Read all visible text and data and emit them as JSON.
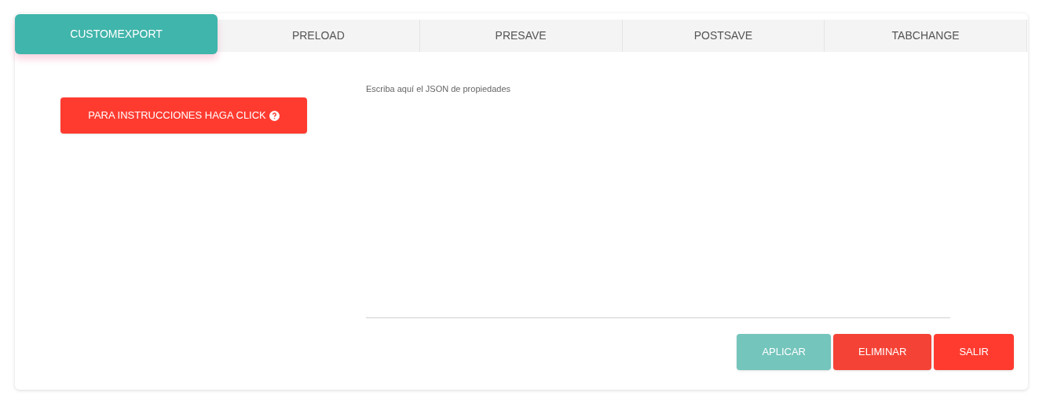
{
  "tabs": [
    {
      "label": "CUSTOMEXPORT",
      "selected": true
    },
    {
      "label": "PRELOAD",
      "selected": false
    },
    {
      "label": "PRESAVE",
      "selected": false
    },
    {
      "label": "POSTSAVE",
      "selected": false
    },
    {
      "label": "TABCHANGE",
      "selected": false
    }
  ],
  "instructions_button": {
    "label": "PARA INSTRUCCIONES HAGA CLICK"
  },
  "json_field": {
    "placeholder": "Escriba aquí el JSON de propiedades"
  },
  "actions": [
    {
      "label": "APLICAR",
      "kind": "primary",
      "disabled": true
    },
    {
      "label": "ELIMINAR",
      "kind": "danger",
      "disabled": false
    },
    {
      "label": "SALIR",
      "kind": "exit",
      "disabled": false
    }
  ]
}
